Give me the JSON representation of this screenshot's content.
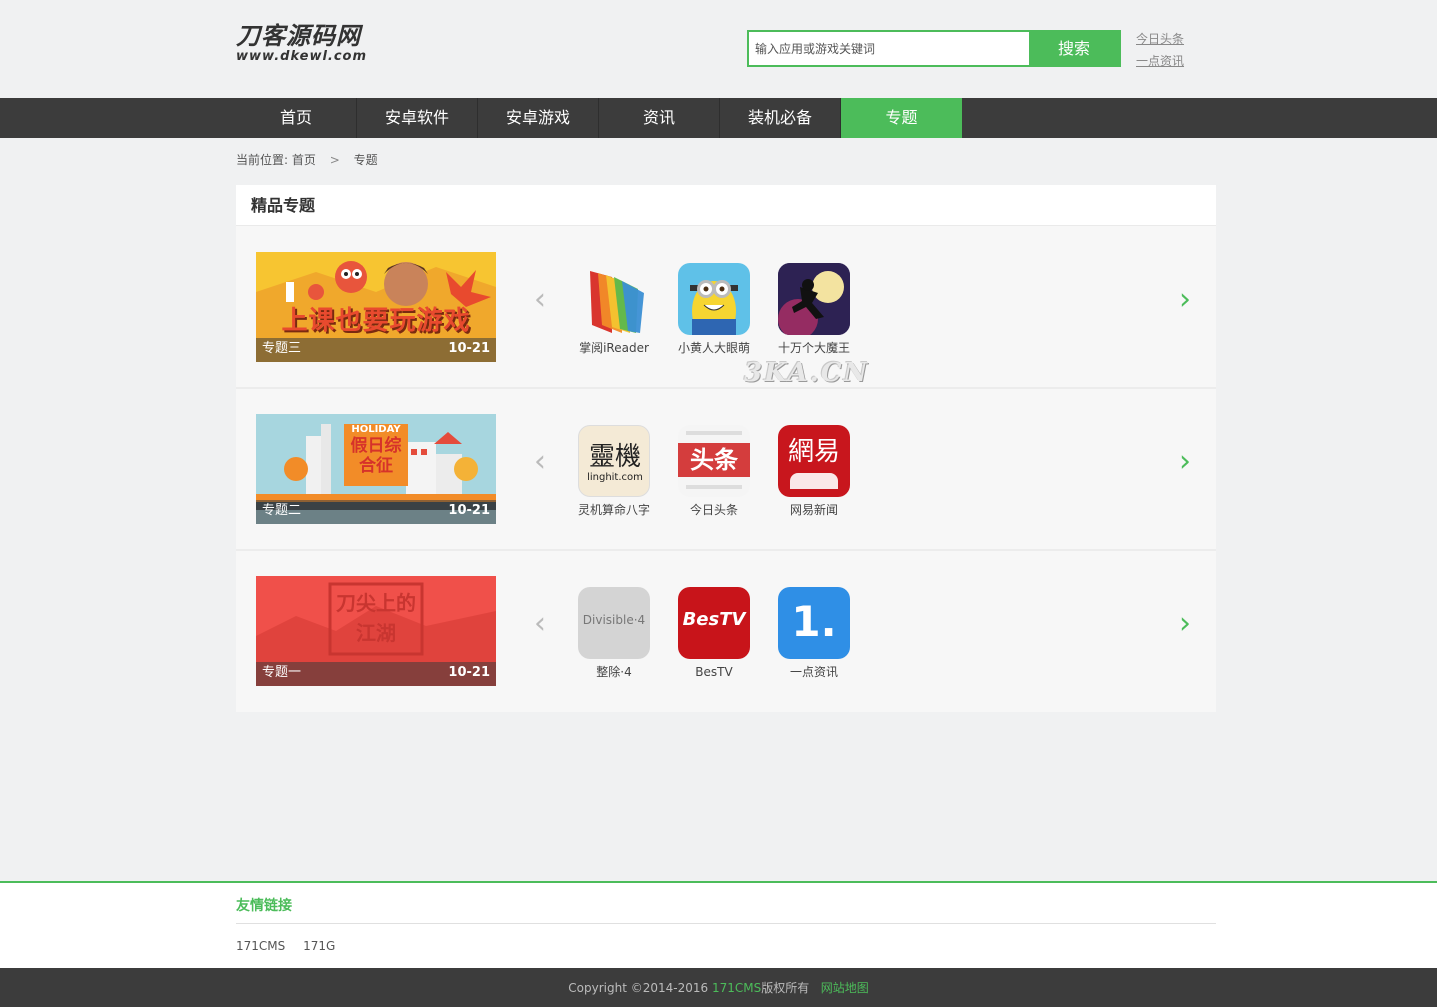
{
  "logo": {
    "cn": "刀客源码网",
    "en": "www.dkewl.com"
  },
  "search": {
    "placeholder": "输入应用或游戏关键词",
    "button": "搜索"
  },
  "hotlinks": [
    "今日头条",
    "一点资讯"
  ],
  "nav": [
    "首页",
    "安卓软件",
    "安卓游戏",
    "资讯",
    "装机必备",
    "专题"
  ],
  "nav_active_index": 5,
  "breadcrumb": {
    "label": "当前位置:",
    "home": "首页",
    "sep": ">",
    "current": "专题"
  },
  "panel_title": "精品专题",
  "topics": [
    {
      "name": "专题三",
      "date": "10-21",
      "banner_text": "上课也要玩游戏",
      "apps": [
        "掌阅iReader",
        "小黄人大眼萌",
        "十万个大魔王"
      ]
    },
    {
      "name": "专题二",
      "date": "10-21",
      "banner_text": "假日综合征",
      "banner_sub": "HOLIDAY",
      "apps": [
        "灵机算命八字",
        "今日头条",
        "网易新闻"
      ]
    },
    {
      "name": "专题一",
      "date": "10-21",
      "banner_text": "刀尖上的江湖",
      "apps": [
        "整除·4",
        "BesTV",
        "一点资讯"
      ]
    }
  ],
  "icon_texts": {
    "lingji": "靈機",
    "lingji_sub": "linghit.com",
    "toutiao": "头条",
    "netease": "網易",
    "divisible": "Divisible·4",
    "bestv": "BesTV",
    "yidian": "1."
  },
  "watermark": "3KA.CN",
  "friend_links": {
    "title": "友情链接",
    "items": [
      "171CMS",
      "171G"
    ]
  },
  "footer": {
    "copy": "Copyright ©2014-2016 ",
    "brand": "171CMS",
    "rights": "版权所有",
    "sitemap": "网站地图"
  },
  "colors": {
    "accent": "#4cbc5a",
    "nav_bg": "#3c3c3c",
    "page_bg": "#f0f1f2"
  }
}
